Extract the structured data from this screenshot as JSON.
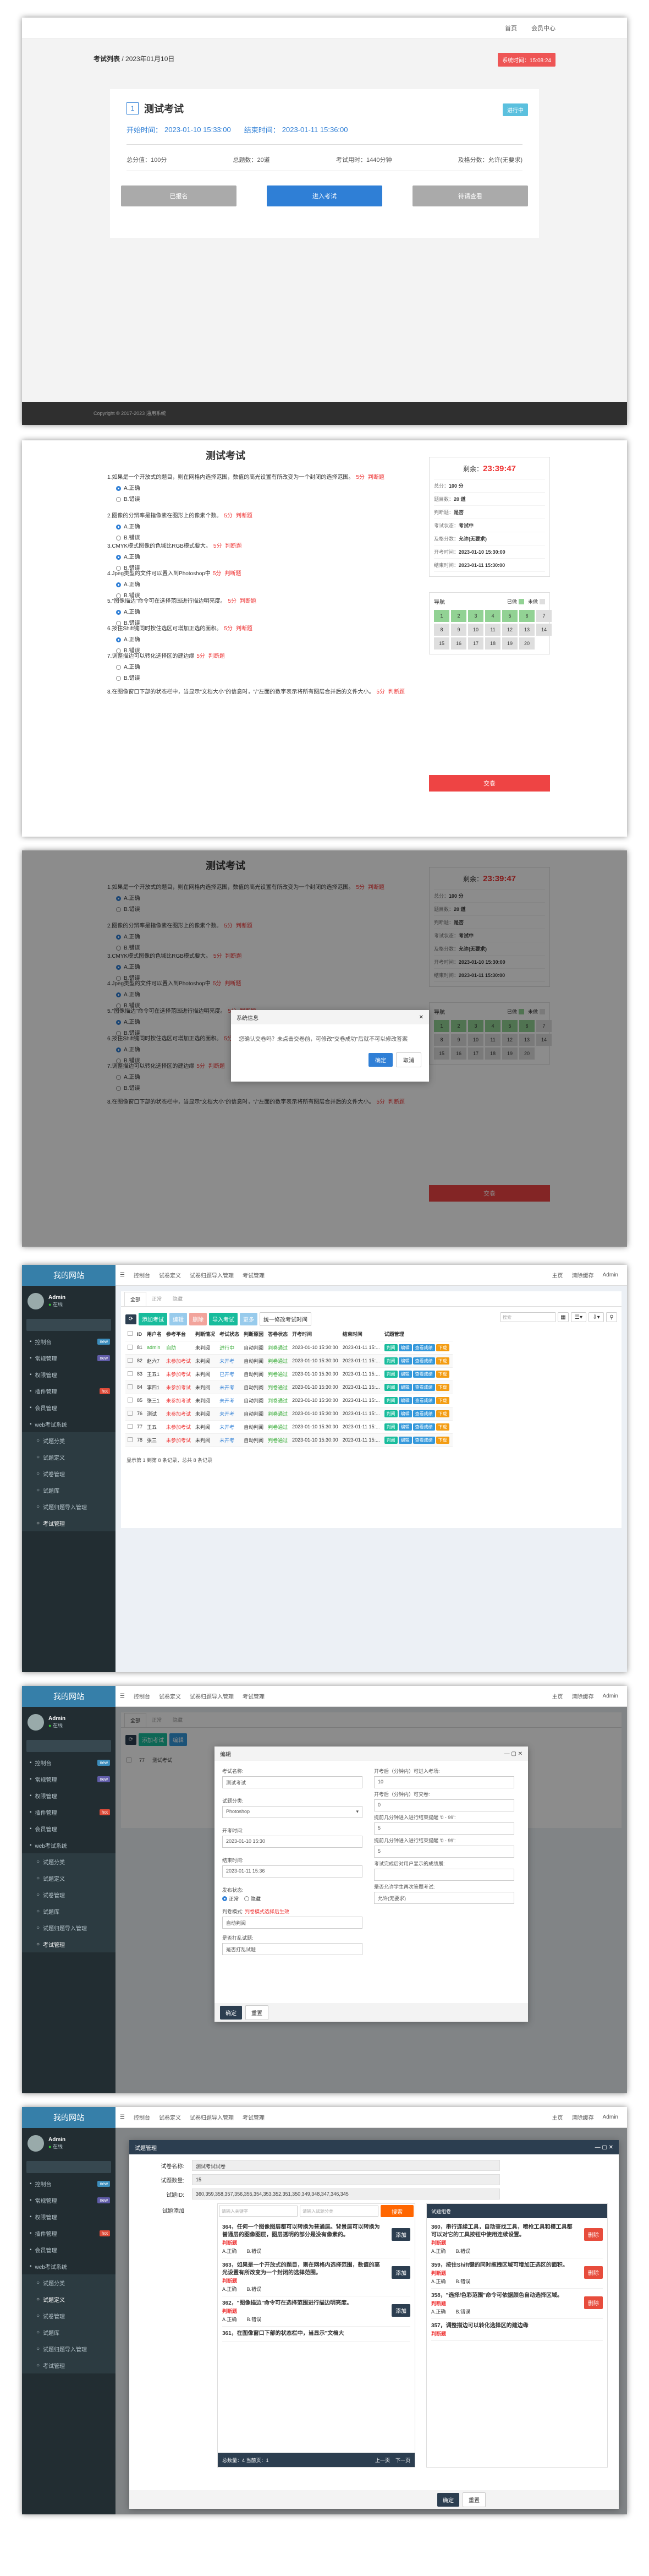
{
  "p1": {
    "nav": [
      "首页",
      "会员中心"
    ],
    "breadcrumb_link": "考试列表",
    "breadcrumb_rest": " / 2023年01月10日",
    "badge": "系统时间：15:08:24",
    "exam_num": "1",
    "exam_name": "测试考试",
    "status": "进行中",
    "start_label": "开始时间：",
    "start_time": "2023-01-10 15:33:00",
    "end_label": "结束时间：",
    "end_time": "2023-01-11 15:36:00",
    "score_total": "总分值：100分",
    "q_count": "总题数：20道",
    "duration": "考试用时：1440分钟",
    "pass_score": "及格分数：允许(无要求)",
    "btns": [
      "已报名",
      "进入考试",
      "待请查看"
    ],
    "footer": "Copyright © 2017-2023 通用系统"
  },
  "exam": {
    "title": "测试考试",
    "questions": [
      {
        "text": "1.如果是一个开放式的题目，则在网格内选择范围，数值的高光设置有所改变为一个封闭的选择范围。",
        "score": "5分",
        "tag": "判断题",
        "opts": [
          "A.正确",
          "B.错误"
        ],
        "sel": 0
      },
      {
        "text": "2.图像的分辨率是指像素在图形上的像素个数。",
        "score": "5分",
        "tag": "判断题",
        "opts": [
          "A.正确",
          "B.错误"
        ],
        "sel": 0
      },
      {
        "text": "3.CMYK模式图像的色域比RGB模式要大。",
        "score": "5分",
        "tag": "判断题",
        "opts": [
          "A.正确",
          "B.错误"
        ],
        "sel": 0
      },
      {
        "text": "4.Jpeg类型的文件可以置入到Photoshop中",
        "score": "5分",
        "tag": "判断题",
        "opts": [
          "A.正确",
          "B.错误"
        ],
        "sel": 0
      },
      {
        "text": "5.\"图像描边\"命令可在选择范围进行描边明亮度。",
        "score": "5分",
        "tag": "判断题",
        "opts": [
          "A.正确",
          "B.错误"
        ],
        "sel": 0
      },
      {
        "text": "6.按住Shift键同时按住选区可增加正选的面积。",
        "score": "5分",
        "tag": "判断题",
        "opts": [
          "A.正确",
          "B.错误"
        ],
        "sel": 0
      },
      {
        "text": "7.调整描边可以转化选择区的建边缘",
        "score": "5分",
        "tag": "判断题",
        "opts": [
          "A.正确",
          "B.错误"
        ],
        "sel": -1
      },
      {
        "text": "8.在图像窗口下部的状态栏中，当显示\"文档大小\"的信息时，\"/\"左面的数字表示将所有图层合并后的文件大小。",
        "score": "5分",
        "tag": "判断题",
        "opts": [],
        "sel": -1
      }
    ],
    "remain_label": "剩余：",
    "remain": "23:39:47",
    "info": [
      [
        "总分：",
        "100 分"
      ],
      [
        "题目数：",
        "20 道"
      ],
      [
        "判断题：",
        "是否"
      ],
      [
        "考试状态：",
        "考试中"
      ],
      [
        "及格分数：",
        "允许(无要求)"
      ],
      [
        "开考时间：",
        "2023-01-10 15:30:00"
      ],
      [
        "结束时间：",
        "2023-01-11 15:30:00"
      ]
    ],
    "nav_label": "导航",
    "legend_done": "已做",
    "legend_todo": "未做",
    "nav_nums": [
      "1",
      "2",
      "3",
      "4",
      "5",
      "6",
      "7",
      "8",
      "9",
      "10",
      "11",
      "12",
      "13",
      "14",
      "15",
      "16",
      "17",
      "18",
      "19",
      "20"
    ],
    "submit": "交卷"
  },
  "confirm": {
    "title": "系统信息",
    "body": "您确认交卷吗？未点击交卷前，可修改\"交卷成功\"后就不可以修改答案",
    "ok": "确定",
    "cancel": "取消"
  },
  "admin": {
    "brand": "我的网站",
    "user": "Admin",
    "online": "在线",
    "menu": [
      {
        "label": "控制台",
        "tag": "new",
        "tagc": "#3c8dbc"
      },
      {
        "label": "常规管理",
        "tag": "new",
        "tagc": "#605ca8"
      },
      {
        "label": "权限管理",
        "tag": "",
        "tagc": ""
      },
      {
        "label": "插件管理",
        "tag": "hot",
        "tagc": "#dd4b39"
      },
      {
        "label": "会员管理",
        "tag": "",
        "tagc": ""
      },
      {
        "label": "web考试系统",
        "tag": "",
        "tagc": ""
      }
    ],
    "submenu": [
      "试题分类",
      "试题定义",
      "试卷管理",
      "试题库",
      "试题归题导入管理",
      "考试管理"
    ],
    "topnav": [
      "控制台",
      "试卷定义",
      "试卷归题导入管理",
      "考试管理"
    ],
    "topright": [
      "主页",
      "清除缓存",
      "Admin"
    ],
    "tabs": [
      "全部",
      "正常",
      "隐藏"
    ],
    "tools": [
      "添加考试",
      "编辑",
      "删除",
      "导入考试",
      "更多",
      "统一修改考试时间"
    ],
    "search_ph": "搜索",
    "cols": [
      "ID",
      "用户名",
      "参考平台",
      "判断情况",
      "考试状态",
      "判断原因",
      "答卷状态",
      "开考时间",
      "结束时间",
      "试题管理"
    ],
    "rows": [
      [
        "81",
        "admin",
        "自助",
        "未判阅",
        "进行中",
        "自动判阅",
        "判卷通过",
        "2023-01-10 15:30:00",
        "2023-01-11 15:..."
      ],
      [
        "82",
        "赵六7",
        "未参加考试",
        "未判阅",
        "未开考",
        "自动判阅",
        "判卷通过",
        "2023-01-10 15:30:00",
        "2023-01-11 15:..."
      ],
      [
        "83",
        "王五1",
        "未参加考试",
        "未判阅",
        "已开考",
        "自动判阅",
        "判卷通过",
        "2023-01-10 15:30:00",
        "2023-01-11 15:..."
      ],
      [
        "84",
        "李四1",
        "未参加考试",
        "未判阅",
        "未开考",
        "自动判阅",
        "判卷通过",
        "2023-01-10 15:30:00",
        "2023-01-11 15:..."
      ],
      [
        "85",
        "张三1",
        "未参加考试",
        "未判阅",
        "未开考",
        "自动判阅",
        "判卷通过",
        "2023-01-10 15:30:00",
        "2023-01-11 15:..."
      ],
      [
        "76",
        "测试",
        "未参加考试",
        "未判阅",
        "未开考",
        "自动判阅",
        "判卷通过",
        "2023-01-10 15:30:00",
        "2023-01-11 15:..."
      ],
      [
        "77",
        "王五",
        "未参加考试",
        "未判阅",
        "未开考",
        "自动判阅",
        "判卷通过",
        "2023-01-10 15:30:00",
        "2023-01-11 15:..."
      ],
      [
        "78",
        "张三",
        "未参加考试",
        "未判阅",
        "未开考",
        "自动判阅",
        "判卷通过",
        "2023-01-10 15:30:00",
        "2023-01-11 15:..."
      ]
    ],
    "row_actions": [
      "判阅",
      "编辑",
      "查看成绩",
      "下载"
    ],
    "pager": "显示第 1 到第 8 条记录，总共 8 条记录"
  },
  "edit": {
    "title": "编辑",
    "left": [
      [
        "考试名称:",
        "测试考试"
      ],
      [
        "试题分类:",
        "Photoshop"
      ],
      [
        "开考时间:",
        "2023-01-10 15:30"
      ],
      [
        "结束时间:",
        "2023-01-11 15:36"
      ]
    ],
    "right": [
      [
        "开考后（分钟内）可进入考场:",
        "10"
      ],
      [
        "开考后（分钟内）可交卷:",
        "0"
      ],
      [
        "提前几分钟进入进行结束提醒 '0 - 99':",
        "5"
      ],
      [
        "提前几分钟进入进行结束提醒 '0 - 99':",
        "5"
      ],
      [
        "考试完成后对用户显示的成绩展:",
        ""
      ],
      [
        "是否允许学生再次答题考试:",
        "允许(无要求)"
      ]
    ],
    "pub_label": "发布状态:",
    "pub_opts": [
      "正常",
      "隐藏"
    ],
    "judge_label": "判卷模式:",
    "judge_hint": "判卷模式选择后生效",
    "judge_val": "自动判阅",
    "paper_label": "是否打乱试题:",
    "paper_val": "是否打乱试题",
    "ok": "确定",
    "reset": "重置",
    "row": [
      "77",
      "测试考试"
    ]
  },
  "paper": {
    "title": "试题管理",
    "fields": [
      [
        "试卷名称:",
        "测试考试试卷"
      ],
      [
        "试题数量:",
        "15"
      ],
      [
        "试题ID:",
        "360,359,358,357,356,355,354,353,352,351,350,349,348,347,346,345"
      ]
    ],
    "add_label": "试题添加",
    "search1_ph": "请输入关键字",
    "search2_ph": "请输入试题分类",
    "search_btn": "搜索",
    "pool": [
      {
        "text": "364，任何一个图像图层都可以转换为普通层。背景层可以转换为普通层的图像图层，图层透明的部分是没有像素的。",
        "tag": "判断题",
        "opts": [
          "A.正确",
          "B.错误"
        ]
      },
      {
        "text": "363，如果是一个开放式的题目，则在网格内选择范围，数值的高光设置有所改变为一个封闭的选择范围。",
        "tag": "判断题",
        "opts": [
          "A.正确",
          "B.错误"
        ]
      },
      {
        "text": "362，\"图像描边\"命令可在选择范围进行描边明亮度。",
        "tag": "判断题",
        "opts": [
          "A.正确",
          "B.错误"
        ]
      },
      {
        "text": "361，在图像窗口下部的状态栏中，当显示\"文档大",
        "tag": "",
        "opts": []
      }
    ],
    "pool_pager": "总数量：4  当前页：1",
    "prev": "上一页",
    "next": "下一页",
    "chosen_label": "试题组卷",
    "chosen": [
      {
        "text": "360，串行连续工具，自动查找工具，喷枪工具和模工具都可以对它的工具按钮中使用连续设置。",
        "tag": "判断题",
        "opts": [
          "A.正确",
          "B.错误"
        ]
      },
      {
        "text": "359，按住Shift键的同时拖拽区域可增加正选区的面积。",
        "tag": "判断题",
        "opts": [
          "A.正确",
          "B.错误"
        ]
      },
      {
        "text": "358，\"选择/色彩范围\"命令可依据颜色自动选择区域。",
        "tag": "判断题",
        "opts": [
          "A.正确",
          "B.错误"
        ]
      },
      {
        "text": "357，调整描边可以转化选择区的建边缘",
        "tag": "判断题",
        "opts": []
      }
    ],
    "add_btn": "添加",
    "remove_btn": "删除",
    "ok": "确定",
    "reset": "重置"
  }
}
